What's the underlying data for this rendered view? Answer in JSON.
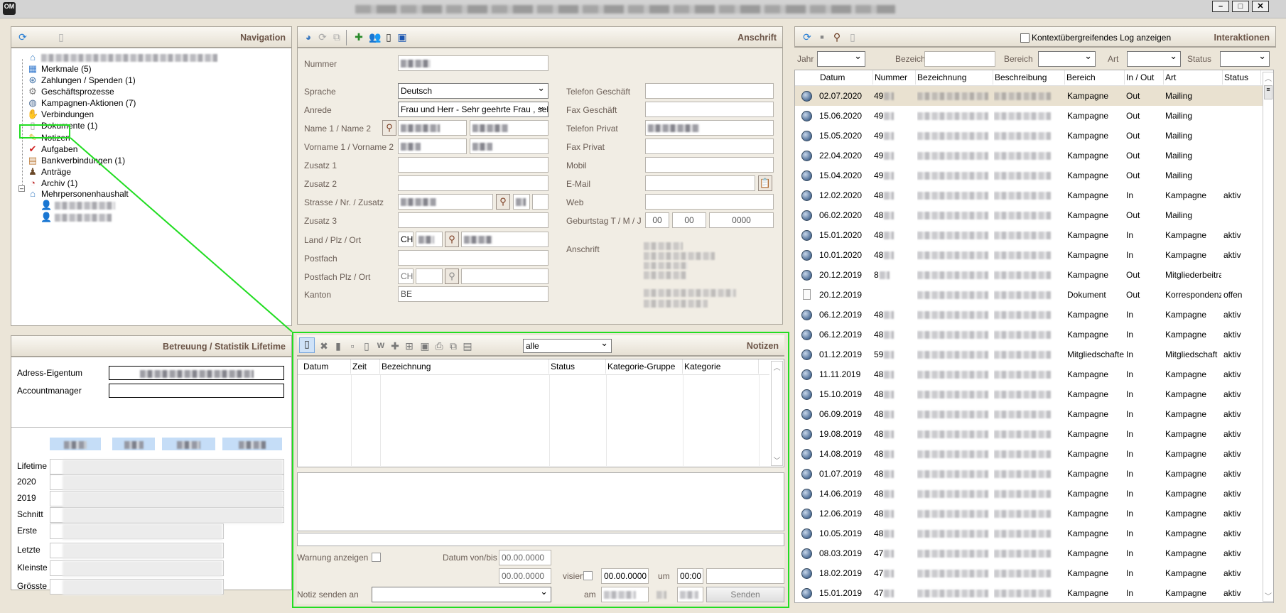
{
  "window": {
    "app_icon": "OM",
    "controls": {
      "minimize": "minimize-icon",
      "maximize": "maximize-icon",
      "close": "close-icon"
    }
  },
  "navigation": {
    "title": "Navigation",
    "toolbar_icons": [
      "refresh-icon",
      "document-settings-icon"
    ],
    "items": [
      {
        "label": "Merkmale (5)",
        "icon": "cubes-icon",
        "glyph": "▦",
        "color": "#3d7fd0"
      },
      {
        "label": "Zahlungen / Spenden (1)",
        "icon": "payments-icon",
        "glyph": "⊛",
        "color": "#3b6ea5"
      },
      {
        "label": "Geschäftsprozesse",
        "icon": "gear-icon",
        "glyph": "⚙",
        "color": "#777777"
      },
      {
        "label": "Kampagnen-Aktionen (7)",
        "icon": "globe-icon",
        "glyph": "◍",
        "color": "#4f6f97"
      },
      {
        "label": "Verbindungen",
        "icon": "handshake-icon",
        "glyph": "✋",
        "color": "#b07850"
      },
      {
        "label": "Dokumente (1)",
        "icon": "document-icon",
        "glyph": "▯",
        "color": "#999999"
      },
      {
        "label": "Notizen",
        "icon": "note-icon",
        "glyph": "✎",
        "color": "#d8b520"
      },
      {
        "label": "Aufgaben",
        "icon": "checkmark-icon",
        "glyph": "✔",
        "color": "#d02020"
      },
      {
        "label": "Bankverbindungen (1)",
        "icon": "bank-card-icon",
        "glyph": "▤",
        "color": "#c08040"
      },
      {
        "label": "Anträge",
        "icon": "stamp-icon",
        "glyph": "♟",
        "color": "#6b4a2a"
      },
      {
        "label": "Archiv (1)",
        "icon": "archive-clock-icon",
        "glyph": "◔",
        "color": "#c03030"
      },
      {
        "label": "Mehrpersonenhaushalt",
        "icon": "house-icon",
        "glyph": "⌂",
        "color": "#3b7fc4"
      }
    ]
  },
  "betreuung": {
    "title": "Betreuung / Statistik Lifetime",
    "adress_eigentum_label": "Adress-Eigentum",
    "accountmanager_label": "Accountmanager",
    "stat_rows": [
      "Lifetime",
      "2020",
      "2019",
      "Schnitt",
      "Erste",
      "Letzte",
      "Kleinste",
      "Grösste"
    ]
  },
  "anschrift": {
    "title": "Anschrift",
    "toolbar_icons": [
      "globe-icon",
      "refresh-icon",
      "copy-icon",
      "add-attachment-icon",
      "persons-icon",
      "new-document-icon",
      "save-icon"
    ],
    "labels": {
      "nummer": "Nummer",
      "sprache": "Sprache",
      "anrede": "Anrede",
      "name": "Name 1 / Name 2",
      "vorname": "Vorname 1 / Vorname 2",
      "zusatz1": "Zusatz 1",
      "zusatz2": "Zusatz 2",
      "strasse": "Strasse / Nr. / Zusatz",
      "zusatz3": "Zusatz 3",
      "land": "Land / Plz / Ort",
      "postfach": "Postfach",
      "postfach_plz": "Postfach Plz / Ort",
      "kanton": "Kanton",
      "tel_geschaeft": "Telefon Geschäft",
      "fax_geschaeft": "Fax Geschäft",
      "tel_privat": "Telefon Privat",
      "fax_privat": "Fax Privat",
      "mobil": "Mobil",
      "email": "E-Mail",
      "web": "Web",
      "geburtstag": "Geburtstag T / M / J",
      "anschrift": "Anschrift"
    },
    "values": {
      "sprache": "Deutsch",
      "anrede": "Frau und Herr -  Sehr geehrte Frau , sehr",
      "land": "CH",
      "postfach_land": "CH",
      "kanton": "BE",
      "geburtstag_t": "00",
      "geburtstag_m": "00",
      "geburtstag_j": "0000"
    }
  },
  "notizen": {
    "title": "Notizen",
    "filter": "alle",
    "columns": [
      "Datum",
      "Zeit",
      "Bezeichnung",
      "Status",
      "Kategorie-Gruppe",
      "Kategorie"
    ],
    "warnung_label": "Warnung anzeigen",
    "datum_label": "Datum von/bis",
    "datum_von": "00.00.0000",
    "datum_bis": "00.00.0000",
    "visiert_label": "visiert",
    "visiert_datum": "00.00.0000",
    "um_label": "um",
    "um_zeit": "00:00",
    "senden_an_label": "Notiz senden an",
    "am_label": "am",
    "senden_button": "Senden"
  },
  "interaktionen": {
    "title": "Interaktionen",
    "context_log_label": "Kontextübergreifendes Log anzeigen",
    "filters": {
      "jahr": "Jahr",
      "bezeichnung": "Bezeichnung",
      "bereich": "Bereich",
      "art": "Art",
      "status": "Status"
    },
    "columns": [
      "Datum",
      "Nummer",
      "Bezeichnung",
      "Beschreibung",
      "Bereich",
      "In / Out",
      "Art",
      "Status"
    ],
    "rows": [
      {
        "icon": "globe",
        "date": "02.07.2020",
        "nr": "49",
        "bereich": "Kampagne",
        "io": "Out",
        "art": "Mailing",
        "status": ""
      },
      {
        "icon": "globe",
        "date": "15.06.2020",
        "nr": "49",
        "bereich": "Kampagne",
        "io": "Out",
        "art": "Mailing",
        "status": ""
      },
      {
        "icon": "globe",
        "date": "15.05.2020",
        "nr": "49",
        "bereich": "Kampagne",
        "io": "Out",
        "art": "Mailing",
        "status": ""
      },
      {
        "icon": "globe",
        "date": "22.04.2020",
        "nr": "49",
        "bereich": "Kampagne",
        "io": "Out",
        "art": "Mailing",
        "status": ""
      },
      {
        "icon": "globe",
        "date": "15.04.2020",
        "nr": "49",
        "bereich": "Kampagne",
        "io": "Out",
        "art": "Mailing",
        "status": ""
      },
      {
        "icon": "globe",
        "date": "12.02.2020",
        "nr": "48",
        "bereich": "Kampagne",
        "io": "In",
        "art": "Kampagne",
        "status": "aktiv"
      },
      {
        "icon": "globe",
        "date": "06.02.2020",
        "nr": "48",
        "bereich": "Kampagne",
        "io": "Out",
        "art": "Mailing",
        "status": ""
      },
      {
        "icon": "globe",
        "date": "15.01.2020",
        "nr": "48",
        "bereich": "Kampagne",
        "io": "In",
        "art": "Kampagne",
        "status": "aktiv"
      },
      {
        "icon": "globe",
        "date": "10.01.2020",
        "nr": "48",
        "bereich": "Kampagne",
        "io": "In",
        "art": "Kampagne",
        "status": "aktiv"
      },
      {
        "icon": "globe",
        "date": "20.12.2019",
        "nr": "8",
        "bereich": "Kampagne",
        "io": "Out",
        "art": "Mitgliederbeitrag",
        "status": ""
      },
      {
        "icon": "doc",
        "date": "20.12.2019",
        "nr": "",
        "bereich": "Dokument",
        "io": "Out",
        "art": "Korrespondenz",
        "status": "offen"
      },
      {
        "icon": "globe",
        "date": "06.12.2019",
        "nr": "48",
        "bereich": "Kampagne",
        "io": "In",
        "art": "Kampagne",
        "status": "aktiv"
      },
      {
        "icon": "globe",
        "date": "06.12.2019",
        "nr": "48",
        "bereich": "Kampagne",
        "io": "In",
        "art": "Kampagne",
        "status": "aktiv"
      },
      {
        "icon": "globe",
        "date": "01.12.2019",
        "nr": "59",
        "bereich": "Mitgliedschaften",
        "io": "In",
        "art": "Mitgliedschaft",
        "status": "aktiv"
      },
      {
        "icon": "globe",
        "date": "11.11.2019",
        "nr": "48",
        "bereich": "Kampagne",
        "io": "In",
        "art": "Kampagne",
        "status": "aktiv"
      },
      {
        "icon": "globe",
        "date": "15.10.2019",
        "nr": "48",
        "bereich": "Kampagne",
        "io": "In",
        "art": "Kampagne",
        "status": "aktiv"
      },
      {
        "icon": "globe",
        "date": "06.09.2019",
        "nr": "48",
        "bereich": "Kampagne",
        "io": "In",
        "art": "Kampagne",
        "status": "aktiv"
      },
      {
        "icon": "globe",
        "date": "19.08.2019",
        "nr": "48",
        "bereich": "Kampagne",
        "io": "In",
        "art": "Kampagne",
        "status": "aktiv"
      },
      {
        "icon": "globe",
        "date": "14.08.2019",
        "nr": "48",
        "bereich": "Kampagne",
        "io": "In",
        "art": "Kampagne",
        "status": "aktiv"
      },
      {
        "icon": "globe",
        "date": "01.07.2019",
        "nr": "48",
        "bereich": "Kampagne",
        "io": "In",
        "art": "Kampagne",
        "status": "aktiv"
      },
      {
        "icon": "globe",
        "date": "14.06.2019",
        "nr": "48",
        "bereich": "Kampagne",
        "io": "In",
        "art": "Kampagne",
        "status": "aktiv"
      },
      {
        "icon": "globe",
        "date": "12.06.2019",
        "nr": "48",
        "bereich": "Kampagne",
        "io": "In",
        "art": "Kampagne",
        "status": "aktiv"
      },
      {
        "icon": "globe",
        "date": "10.05.2019",
        "nr": "48",
        "bereich": "Kampagne",
        "io": "In",
        "art": "Kampagne",
        "status": "aktiv"
      },
      {
        "icon": "globe",
        "date": "08.03.2019",
        "nr": "47",
        "bereich": "Kampagne",
        "io": "In",
        "art": "Kampagne",
        "status": "aktiv"
      },
      {
        "icon": "globe",
        "date": "18.02.2019",
        "nr": "47",
        "bereich": "Kampagne",
        "io": "In",
        "art": "Kampagne",
        "status": "aktiv"
      },
      {
        "icon": "globe",
        "date": "15.01.2019",
        "nr": "47",
        "bereich": "Kampagne",
        "io": "In",
        "art": "Kampagne",
        "status": "aktiv"
      }
    ]
  },
  "colors": {
    "highlight": "#22dd22",
    "panel_title": "#6b5447",
    "selected_row": "#e9e1d0",
    "stat_header": "#c5ddf7"
  }
}
